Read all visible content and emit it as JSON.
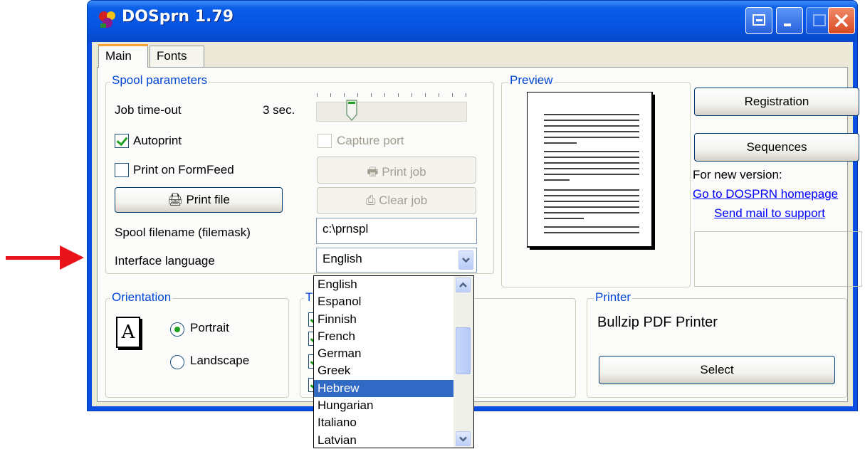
{
  "window": {
    "title": "DOSprn 1.79"
  },
  "tabs": [
    {
      "label": "Main"
    },
    {
      "label": "Fonts"
    }
  ],
  "spool": {
    "group_label": "Spool parameters",
    "job_timeout_label": "Job time-out",
    "job_timeout_value": "3 sec.",
    "autoprint_label": "Autoprint",
    "autoprint_checked": true,
    "print_on_formfeed_label": "Print on FormFeed",
    "print_on_formfeed_checked": false,
    "capture_port_label": "Capture port",
    "print_file_label": "Print file",
    "print_job_label": "Print job",
    "clear_job_label": "Clear job",
    "filename_label": "Spool filename (filemask)",
    "filename_value": "c:\\prnspl",
    "language_label": "Interface language",
    "language_value": "English",
    "language_options": [
      "English",
      "Espanol",
      "Finnish",
      "French",
      "German",
      "Greek",
      "Hebrew",
      "Hungarian",
      "Italiano",
      "Latvian"
    ],
    "language_highlighted": "Hebrew"
  },
  "preview": {
    "group_label": "Preview"
  },
  "side": {
    "registration_label": "Registration",
    "sequences_label": "Sequences",
    "new_version_text": "For new version:",
    "homepage_link": "Go to DOSPRN homepage",
    "mail_link": "Send mail to support"
  },
  "orientation": {
    "group_label": "Orientation",
    "icon_letter": "A",
    "portrait_label": "Portrait",
    "landscape_label": "Landscape",
    "selected": "Portrait"
  },
  "second_group": {
    "group_label_partial": "T"
  },
  "printer": {
    "group_label": "Printer",
    "name": "Bullzip PDF Printer",
    "select_label": "Select"
  },
  "colors": {
    "accent": "#0046d5",
    "selection": "#316ac5",
    "arrow": "#e8121a",
    "titlebar": "#0554e3"
  }
}
